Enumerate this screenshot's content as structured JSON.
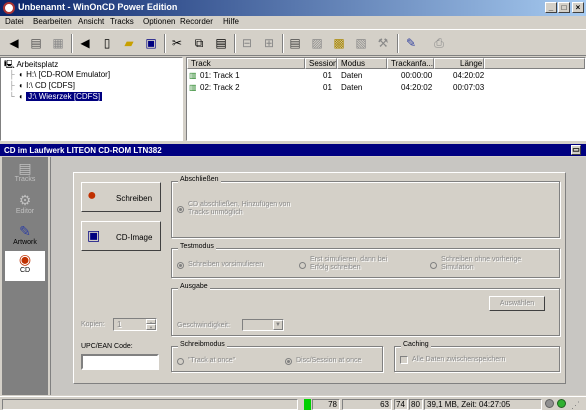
{
  "window": {
    "title": "Unbenannt - WinOnCD Power Edition",
    "min_glyph": "_",
    "max_glyph": "□",
    "close_glyph": "×"
  },
  "menu": [
    "Datei",
    "Bearbeiten",
    "Ansicht",
    "Tracks",
    "Optionen",
    "Recorder",
    "Hilfe"
  ],
  "tree": {
    "root": "Arbeitsplatz",
    "items": [
      "H:\\ [CD-ROM Emulator]",
      "I:\\ CD [CDFS]",
      "J:\\ Wiesrzek [CDFS]"
    ],
    "selected_index": 2
  },
  "tracklist": {
    "columns": [
      "Track",
      "Session",
      "Modus",
      "Trackanfa...",
      "Länge"
    ],
    "rows": [
      {
        "track": "01: Track 1",
        "session": "01",
        "modus": "Daten",
        "start": "00:00:00",
        "length": "04:20:02"
      },
      {
        "track": "02: Track 2",
        "session": "01",
        "modus": "Daten",
        "start": "04:20:02",
        "length": "00:07:03"
      }
    ]
  },
  "cd_panel": {
    "title": "CD im Laufwerk LITEON CD-ROM LTN382"
  },
  "sidebar": {
    "items": [
      "Tracks",
      "Editor",
      "Artwork",
      "CD"
    ],
    "active": "CD"
  },
  "actions": {
    "write_label": "Schreiben",
    "cdimage_label": "CD-Image"
  },
  "abschluss": {
    "legend": "Abschließen",
    "option": "CD abschließen, Hinzufügen von Tracks unmöglich"
  },
  "testmodus": {
    "legend": "Testmodus",
    "options": [
      "Schreiben vorsimulieren",
      "Erst simulieren, dann bei Erfolg schreiben",
      "Schreiben ohne vorherige Simulation"
    ],
    "selected": 0
  },
  "ausgabe": {
    "legend": "Ausgabe",
    "select_button": "Auswählen",
    "speed_label": "Geschwindigkeit:",
    "speed_value": ""
  },
  "kopien": {
    "label": "Kopien:",
    "value": "1"
  },
  "upc": {
    "label": "UPC/EAN Code:",
    "value": ""
  },
  "schreibmodus": {
    "legend": "Schreibmodus",
    "options": [
      "Track at once",
      "Disc/Session at once"
    ],
    "selected": 1
  },
  "caching": {
    "legend": "Caching",
    "checkbox_label": "Alle Daten zwischenspeichern",
    "checked": false
  },
  "statusbar": {
    "count": "78",
    "num1": "63",
    "num2": "74",
    "num3": "80",
    "info": "39,1 MB, Zeit: 04:27:05"
  },
  "colors": {
    "title_start": "#0a246a",
    "title_end": "#a6caf0",
    "selection": "#000080",
    "status_green": "#00d000"
  }
}
